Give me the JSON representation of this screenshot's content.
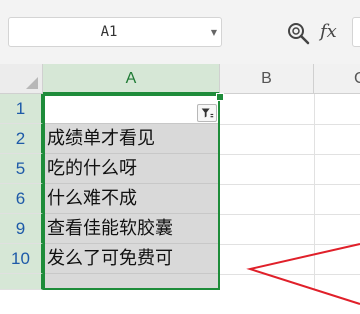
{
  "name_box": {
    "value": "A1"
  },
  "formula_bar": {
    "fx_label": "fx"
  },
  "columns": [
    "A",
    "B",
    "C"
  ],
  "rows": [
    {
      "num": "1",
      "value": ""
    },
    {
      "num": "2",
      "value": "成绩单才看见"
    },
    {
      "num": "5",
      "value": "吃的什么呀"
    },
    {
      "num": "6",
      "value": "什么难不成"
    },
    {
      "num": "9",
      "value": "查看佳能软胶囊"
    },
    {
      "num": "10",
      "value": "发么了可免费可"
    }
  ],
  "colors": {
    "selection": "#1e8c3a",
    "row_number": "#1e5aa8",
    "arrow": "#e0202a"
  },
  "icons": {
    "zoom": "zoom-formula-icon",
    "filter": "filter-icon",
    "dropdown": "chevron-down-icon"
  }
}
